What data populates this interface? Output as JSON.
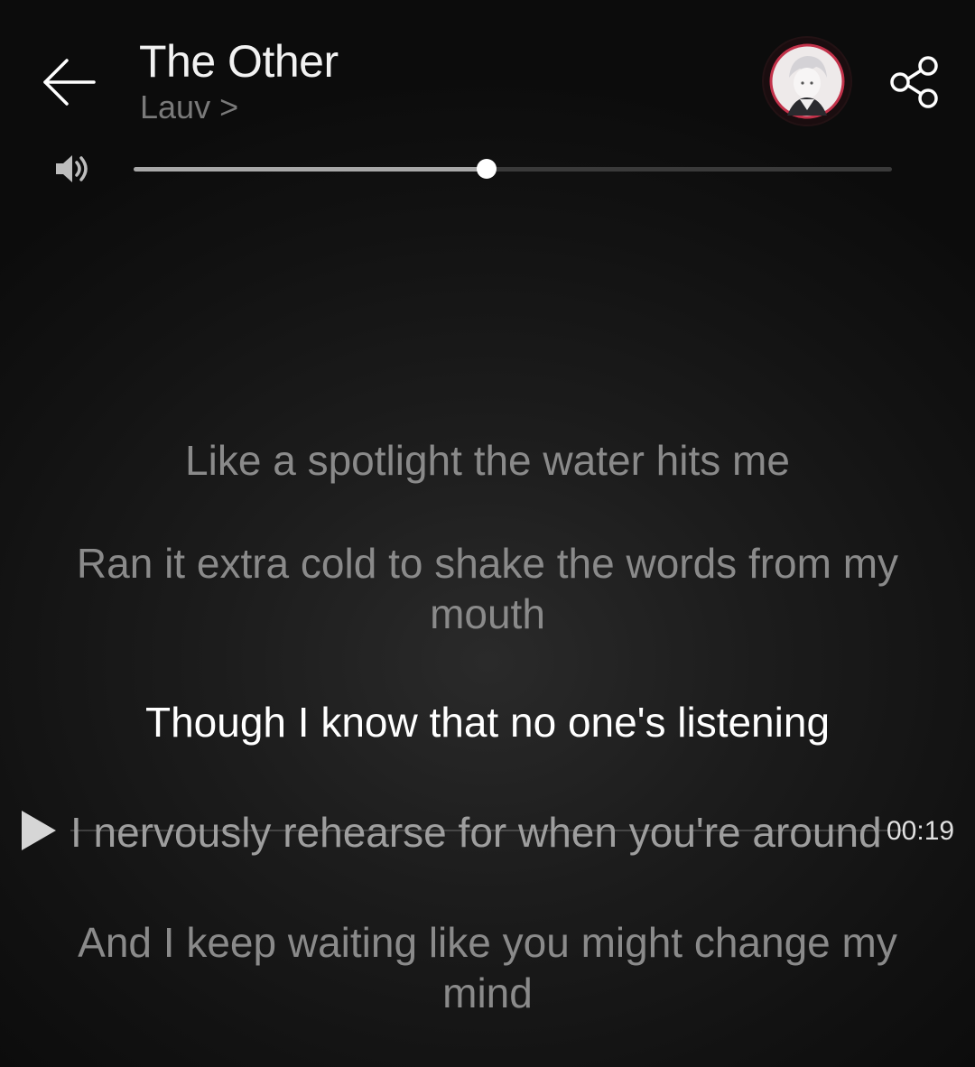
{
  "header": {
    "title": "The Other",
    "artist_label": "Lauv >"
  },
  "icons": {
    "back": "arrow-left-icon",
    "share": "share-icon",
    "volume": "speaker-icon",
    "play": "play-icon"
  },
  "volume": {
    "level": 0.466
  },
  "lyrics": [
    {
      "text": "Like a spotlight the water hits me",
      "state": "past"
    },
    {
      "text": "Ran it extra cold to shake the words from my mouth",
      "state": "past"
    },
    {
      "text": "Though I know that no one's listening",
      "state": "current"
    },
    {
      "text": "I nervously rehearse for when you're around",
      "state": "seek-target"
    },
    {
      "text": "And I keep waiting like you might change my mind",
      "state": "upcoming"
    }
  ],
  "seek": {
    "time": "00:19"
  },
  "colors": {
    "background": "#121212",
    "accent_ring": "#c2324a",
    "inactive_lyric": "#8a8a8a",
    "active_lyric": "#ffffff"
  }
}
